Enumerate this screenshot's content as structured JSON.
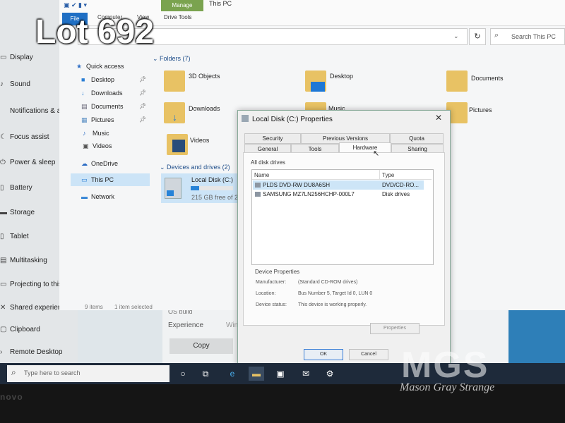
{
  "overlay": {
    "lot_label": "Lot 692",
    "logo_letters": "MGS",
    "logo_name": "Mason Gray Strange"
  },
  "settings": {
    "items": [
      {
        "label": "Display",
        "icon": "display-icon"
      },
      {
        "label": "Sound",
        "icon": "speaker-icon"
      },
      {
        "label": "Notifications & acti",
        "icon": "notification-icon"
      },
      {
        "label": "Focus assist",
        "icon": "moon-icon"
      },
      {
        "label": "Power & sleep",
        "icon": "power-icon"
      },
      {
        "label": "Battery",
        "icon": "battery-icon"
      },
      {
        "label": "Storage",
        "icon": "storage-icon"
      },
      {
        "label": "Tablet",
        "icon": "tablet-icon"
      },
      {
        "label": "Multitasking",
        "icon": "multitasking-icon"
      },
      {
        "label": "Projecting to this PC",
        "icon": "projector-icon"
      },
      {
        "label": "Shared experiences",
        "icon": "shared-icon"
      },
      {
        "label": "Clipboard",
        "icon": "clipboard-icon"
      },
      {
        "label": "Remote Desktop",
        "icon": "remote-icon"
      }
    ],
    "os_build": "OS build",
    "experience_label": "Experience",
    "experience_value": "Wind",
    "copy_button": "Copy"
  },
  "explorer": {
    "tabs": {
      "file": "File",
      "computer": "Computer",
      "view": "View",
      "manage": "Manage",
      "drive_tools": "Drive Tools"
    },
    "title": "This PC",
    "search_placeholder": "Search This PC",
    "nav": {
      "quick_access": "Quick access",
      "desktop": "Desktop",
      "downloads": "Downloads",
      "documents": "Documents",
      "pictures": "Pictures",
      "music": "Music",
      "videos": "Videos",
      "onedrive": "OneDrive",
      "this_pc": "This PC",
      "network": "Network"
    },
    "folders_header": "Folders (7)",
    "folders": [
      "3D Objects",
      "Desktop",
      "Documents",
      "Downloads",
      "Music",
      "Pictures",
      "Videos"
    ],
    "devices_header": "Devices and drives (2)",
    "drive_name": "Local Disk (C:)",
    "drive_free": "215 GB free of 2",
    "drive_used_fraction": 0.2,
    "status_items": "9 items",
    "status_selected": "1 item selected"
  },
  "dialog": {
    "title": "Local Disk (C:) Properties",
    "tabs_row1": [
      "Security",
      "Previous Versions",
      "Quota"
    ],
    "tabs_row2": [
      "General",
      "Tools",
      "Hardware",
      "Sharing"
    ],
    "all_disk_drives": "All disk drives",
    "col_name": "Name",
    "col_type": "Type",
    "drives": [
      {
        "name": "PLDS DVD-RW DU8A6SH",
        "type": "DVD/CD-RO..."
      },
      {
        "name": "SAMSUNG MZ7LN256HCHP-000L7",
        "type": "Disk drives"
      }
    ],
    "device_properties": "Device Properties",
    "manufacturer_label": "Manufacturer:",
    "manufacturer_value": "(Standard CD-ROM drives)",
    "location_label": "Location:",
    "location_value": "Bus Number 5, Target Id 0, LUN 0",
    "status_label": "Device status:",
    "status_value": "This device is working properly.",
    "properties_button": "Properties",
    "ok_button": "OK",
    "cancel_button": "Cancel"
  },
  "taskbar": {
    "search_placeholder": "Type here to search"
  },
  "bezel_brand": "novo"
}
